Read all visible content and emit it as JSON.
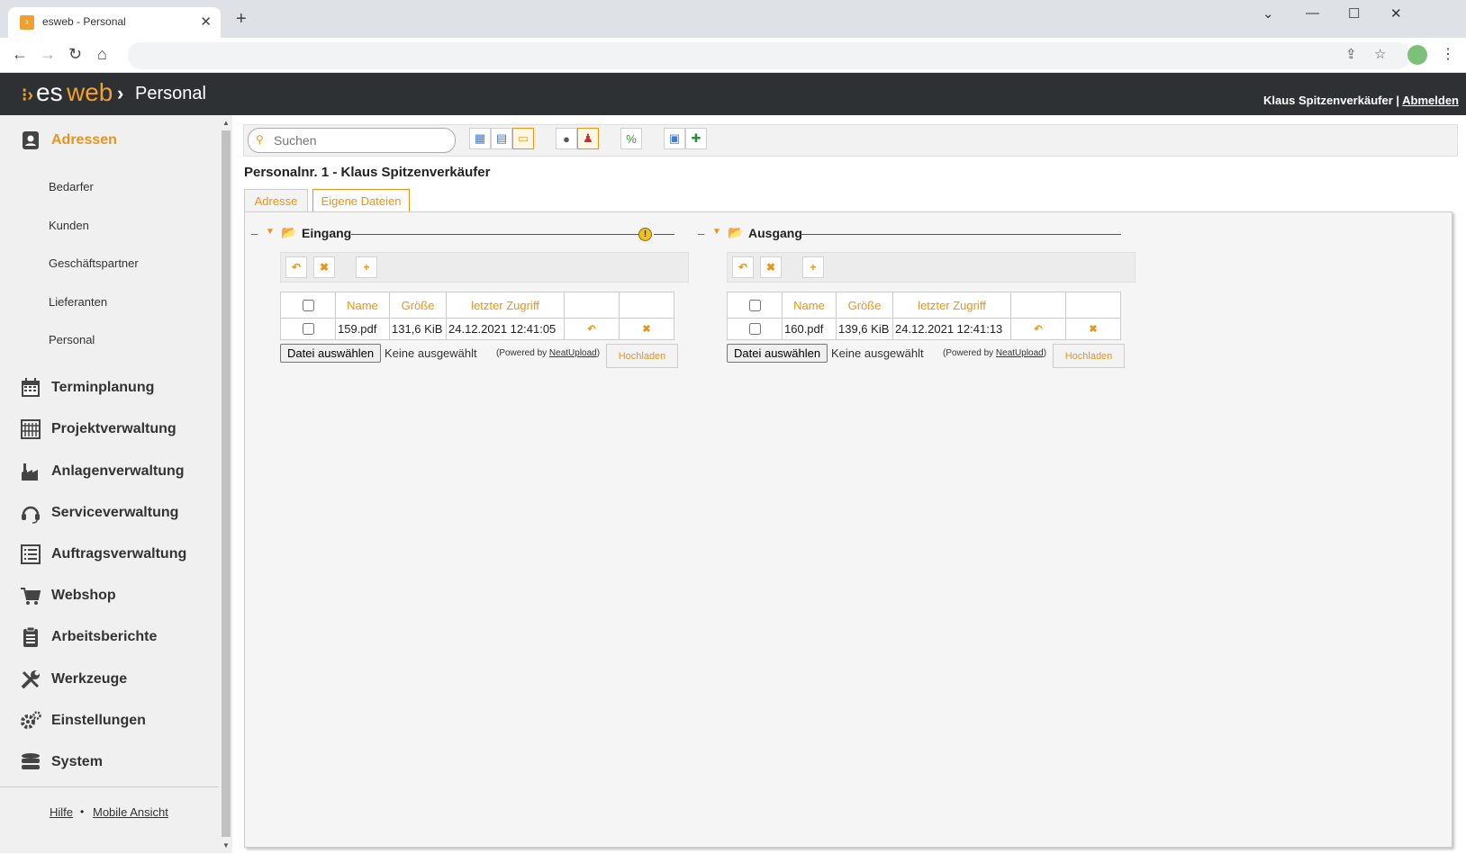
{
  "browser": {
    "tab_title": "esweb - Personal",
    "tab_close": "✕",
    "new_tab": "+",
    "window_min": "⌄",
    "window_min2": "—",
    "window_max": "☐",
    "window_close": "✕",
    "back": "←",
    "forward": "→",
    "reload": "↻",
    "home": "⌂",
    "share_icon": "⇪",
    "star_icon": "☆",
    "menu_icon": "⋮"
  },
  "header": {
    "logo_es": "es",
    "logo_web": "web",
    "separator": "›",
    "module": "Personal",
    "user_name": "Klaus Spitzenverkäufer",
    "user_sep": " | ",
    "logout": "Abmelden"
  },
  "sidebar": {
    "active_item": "Adressen",
    "sub_items": [
      "Bedarfer",
      "Kunden",
      "Geschäftspartner",
      "Lieferanten",
      "Personal"
    ],
    "items": [
      {
        "label": "Terminplanung",
        "icon": "calendar-icon"
      },
      {
        "label": "Projektverwaltung",
        "icon": "project-grid-icon"
      },
      {
        "label": "Anlagenverwaltung",
        "icon": "factory-icon"
      },
      {
        "label": "Serviceverwaltung",
        "icon": "headset-icon"
      },
      {
        "label": "Auftragsverwaltung",
        "icon": "list-icon"
      },
      {
        "label": "Webshop",
        "icon": "cart-icon"
      },
      {
        "label": "Arbeitsberichte",
        "icon": "clipboard-icon"
      },
      {
        "label": "Werkzeuge",
        "icon": "tools-icon"
      },
      {
        "label": "Einstellungen",
        "icon": "gears-icon"
      },
      {
        "label": "System",
        "icon": "database-icon"
      }
    ],
    "footer_help": "Hilfe",
    "footer_dot": "•",
    "footer_mobile": "Mobile Ansicht"
  },
  "toolbar": {
    "search_placeholder": "Suchen"
  },
  "record": {
    "title": "Personalnr. 1 - Klaus Spitzenverkäufer",
    "tabs": [
      "Adresse",
      "Eigene Dateien"
    ],
    "active_tab": "Eigene Dateien"
  },
  "sections": {
    "columns": [
      "Name",
      "Größe",
      "letzter Zugriff"
    ],
    "choose_file": "Datei auswählen",
    "no_file": "Keine ausgewählt",
    "powered_prefix": "(Powered by ",
    "powered_link": "NeatUpload",
    "powered_suffix": ")",
    "upload": "Hochladen",
    "eingang": {
      "title": "Eingang",
      "warning": "!",
      "rows": [
        {
          "name": "159.pdf",
          "size": "131,6 KiB",
          "accessed": "24.12.2021 12:41:05"
        }
      ]
    },
    "ausgang": {
      "title": "Ausgang",
      "rows": [
        {
          "name": "160.pdf",
          "size": "139,6 KiB",
          "accessed": "24.12.2021 12:41:13"
        }
      ]
    }
  }
}
